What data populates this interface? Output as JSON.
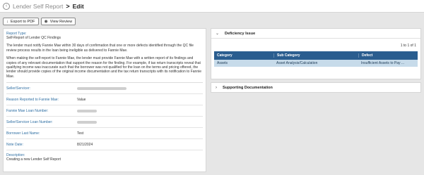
{
  "header": {
    "back_icon": "chevron-left-icon",
    "parent": "Lender Self Report",
    "separator": ">",
    "current": "Edit"
  },
  "toolbar": {
    "export_label": "Export to PDF",
    "view_label": "View Review"
  },
  "report": {
    "type_label": "Report Type:",
    "type_value": "Self-Report of Lender QC Findings",
    "para1": "The lender must notify Fannie Mae within 30 days of confirmation that one or more defects identified through the QC file review process results in the loan being ineligible as delivered to Fannie Mae.",
    "para2": "When making the self-report to Fannie Mae, the lender must provide Fannie Mae with a written report of its findings and copies of any relevant documentation that support the reason for the finding. For example, if tax return transcripts reveal that qualifying income was inaccurate such that the borrower was not qualified for the loan on the terms and pricing offered, the lender should provide copies of the original income documentation and the tax return transcripts with its notification to Fannie Mae."
  },
  "fields": {
    "seller_servicer_label": "Seller/Servicer:",
    "reason_label": "Reason Reported to Fannie Mae:",
    "reason_value": "Value",
    "loan_number_label": "Fannie Mae Loan Number:",
    "servicer_loan_label": "Seller/Servicer Loan Number:",
    "borrower_label": "Borrower Last Name:",
    "borrower_value": "Test",
    "note_date_label": "Note Date:",
    "note_date_value": "8/21/2024",
    "description_label": "Description:",
    "description_value": "Creating a new Lender Self Report"
  },
  "deficiency": {
    "title": "Deficiency Issue",
    "pager": "1 to 1 of 1",
    "columns": [
      "Category",
      "Sub Category",
      "Defect"
    ],
    "rows": [
      [
        "Assets",
        "Asset Analysis/Calculation",
        "Insufficient Assets to Pay ..."
      ]
    ]
  },
  "supporting": {
    "title": "Supporting Documentation"
  }
}
